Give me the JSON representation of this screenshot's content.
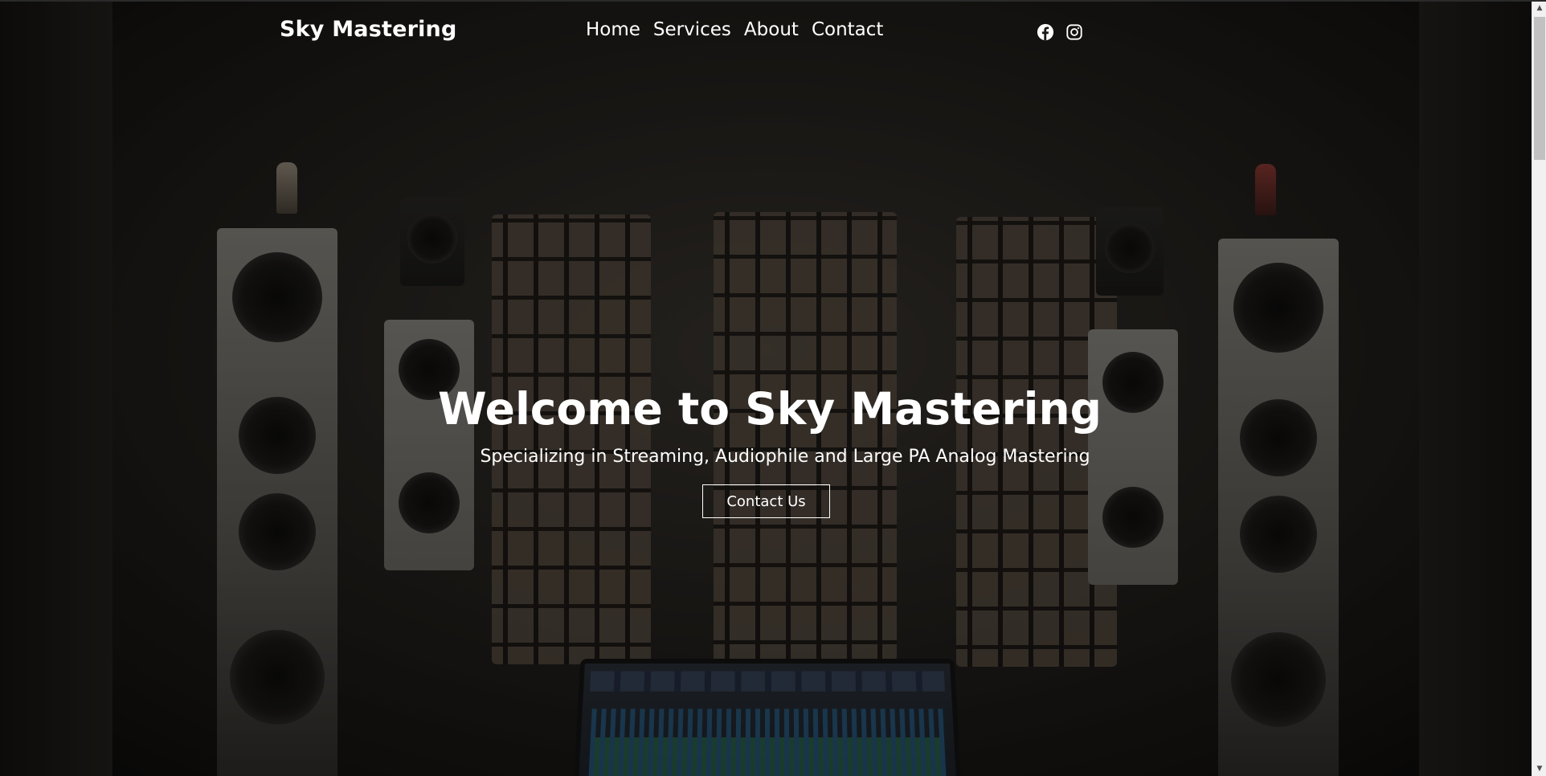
{
  "header": {
    "logo": "Sky Mastering",
    "nav": [
      "Home",
      "Services",
      "About",
      "Contact"
    ],
    "social_icons": [
      "facebook-icon",
      "instagram-icon"
    ]
  },
  "hero": {
    "title": "Welcome to Sky Mastering",
    "subtitle": "Specializing in Streaming, Audiophile and Large PA Analog Mastering",
    "cta_label": "Contact Us"
  },
  "colors": {
    "text": "#ffffff",
    "background_dark": "#1a1816",
    "button_border": "#ffffff"
  }
}
